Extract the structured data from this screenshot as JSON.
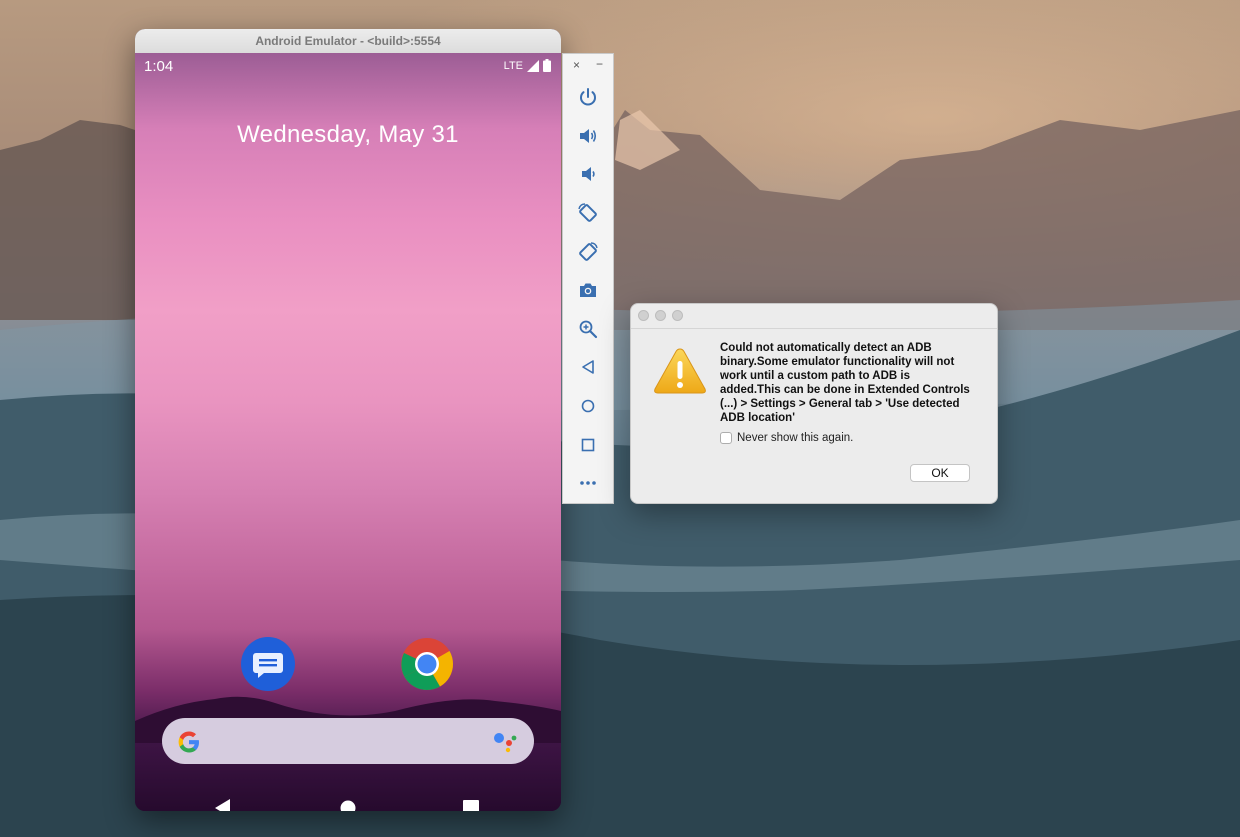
{
  "emulator": {
    "title": "Android Emulator - <build>:5554",
    "status": {
      "time": "1:04",
      "network": "LTE"
    },
    "date": "Wednesday, May 31",
    "apps": [
      {
        "name": "Messages",
        "icon": "messages-icon"
      },
      {
        "name": "Chrome",
        "icon": "chrome-icon"
      }
    ],
    "search": {
      "left_icon": "google-g-icon",
      "right_icon": "google-assistant-icon"
    },
    "nav": [
      "back-icon",
      "home-icon",
      "overview-icon"
    ]
  },
  "toolbar": {
    "close_label": "×",
    "minimize_label": "−",
    "buttons": [
      "power-icon",
      "volume-up-icon",
      "volume-down-icon",
      "rotate-left-icon",
      "rotate-right-icon",
      "camera-icon",
      "zoom-icon",
      "back-icon",
      "home-icon",
      "overview-icon",
      "more-icon"
    ]
  },
  "dialog": {
    "message": "Could not automatically detect an ADB binary.Some emulator functionality will not work until a custom path to ADB  is added.This can be done in Extended Controls (...) > Settings > General tab > 'Use detected ADB location'",
    "checkbox_label": "Never show this again.",
    "checkbox_checked": false,
    "ok_label": "OK",
    "icon": "warning-icon"
  },
  "colors": {
    "messages_blue": "#1f5fd9",
    "warning_yellow": "#f2b61b"
  }
}
